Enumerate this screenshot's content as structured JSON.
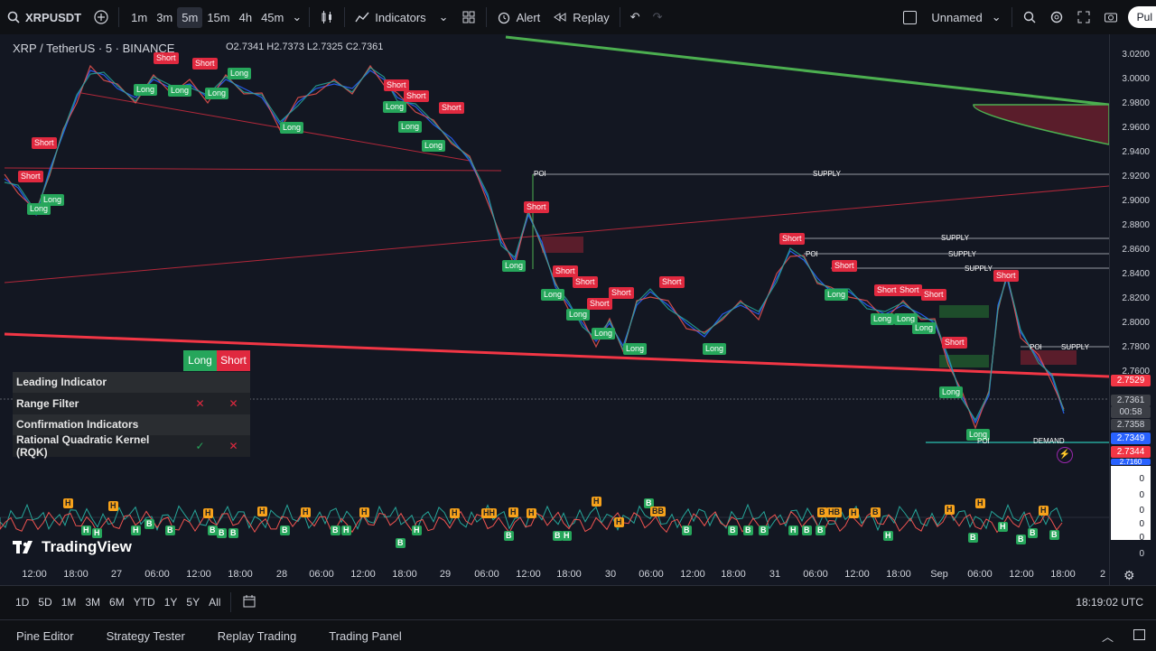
{
  "toolbar": {
    "symbol": "XRPUSDT",
    "timeframes": [
      "1m",
      "3m",
      "5m",
      "15m",
      "4h",
      "45m"
    ],
    "active_timeframe": "5m",
    "indicators_label": "Indicators",
    "alert_label": "Alert",
    "replay_label": "Replay",
    "layout_name": "Unnamed",
    "publish_label": "Pul"
  },
  "legend": {
    "title": "XRP / TetherUS · 5 · BINANCE",
    "ohlc": "O2.7341 H2.7373 L2.7325 C2.7361"
  },
  "price_axis": {
    "labels": [
      "3.0200",
      "3.0000",
      "2.9800",
      "2.9600",
      "2.9400",
      "2.9200",
      "2.9000",
      "2.8800",
      "2.8600",
      "2.8400",
      "2.8200",
      "2.8000",
      "2.7800",
      "2.7600"
    ],
    "tags": {
      "red_price": "2.7529",
      "last": "2.7361",
      "countdown": "00:58",
      "gray_price": "2.7358",
      "blue_price": "2.7349",
      "orange_price": "2.7344",
      "bottom_blue": "2.7160"
    },
    "osc_labels": [
      "0",
      "0",
      "0",
      "0",
      "0",
      "0"
    ]
  },
  "time_axis": [
    "12:00",
    "18:00",
    "27",
    "06:00",
    "12:00",
    "18:00",
    "28",
    "06:00",
    "12:00",
    "18:00",
    "29",
    "06:00",
    "12:00",
    "18:00",
    "30",
    "06:00",
    "12:00",
    "18:00",
    "31",
    "06:00",
    "12:00",
    "18:00",
    "Sep",
    "06:00",
    "12:00",
    "18:00",
    "2"
  ],
  "signals": {
    "long": "Long",
    "short": "Short"
  },
  "zones": {
    "poi": "POI",
    "supply": "SUPPLY",
    "demand": "DEMAND"
  },
  "table": {
    "header_long": "Long",
    "header_short": "Short",
    "rows": [
      {
        "name": "Leading Indicator",
        "long": "",
        "short": ""
      },
      {
        "name": "Range Filter",
        "long": "✕",
        "short": "✕"
      },
      {
        "name": "Confirmation Indicators",
        "long": "",
        "short": ""
      },
      {
        "name": "Rational Quadratic Kernel (RQK)",
        "long": "✓",
        "short": "✕"
      }
    ]
  },
  "oscillator": {
    "h_label": "H",
    "b_label": "B",
    "hh_label": "HH"
  },
  "brand": "TradingView",
  "bottom": {
    "ranges": [
      "1D",
      "5D",
      "1M",
      "3M",
      "6M",
      "YTD",
      "1Y",
      "5Y",
      "All"
    ],
    "clock": "18:19:02 UTC"
  },
  "panels": [
    "Pine Editor",
    "Strategy Tester",
    "Replay Trading",
    "Trading Panel"
  ],
  "colors": {
    "long": "#26a65b",
    "short": "#e0293f",
    "trend_red": "#f23645",
    "trend_green": "#4caf50",
    "candles_up": "#26a69a",
    "candles_down": "#ef5350"
  }
}
